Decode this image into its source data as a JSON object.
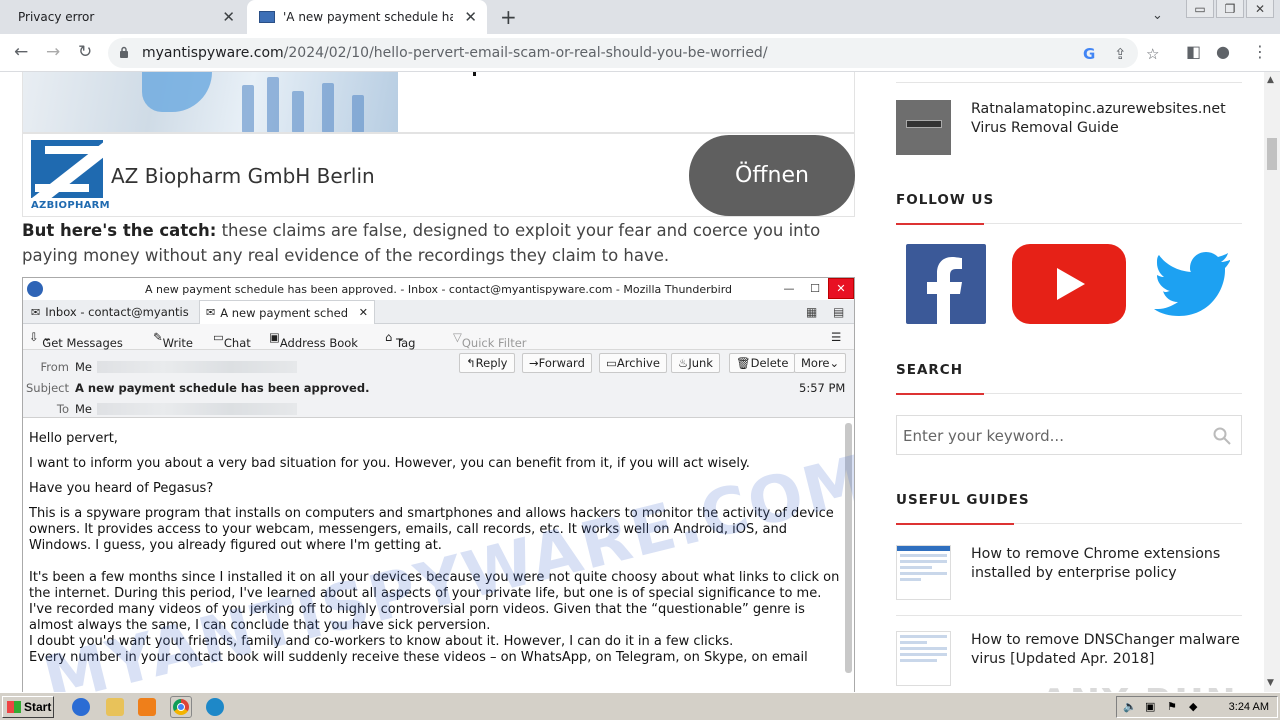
{
  "browser": {
    "tabs": [
      {
        "title": "Privacy error",
        "active": false
      },
      {
        "title": "'A new payment schedule has been a",
        "active": true
      }
    ],
    "url_host": "myantispyware.com",
    "url_path": "/2024/02/10/hello-pervert-email-scam-or-real-should-you-be-worried/"
  },
  "ad": {
    "logo_text": "AZBIOPHARM",
    "title": "AZ Biopharm GmbH Berlin",
    "button": "Öffnen"
  },
  "article": {
    "catch_bold": "But here's the catch:",
    "catch_text": " these claims are false, designed to exploit your fear and coerce you into paying money without any real evidence of the recordings they claim to have."
  },
  "thunderbird": {
    "window_title": "A new payment schedule has been approved. - Inbox - contact@myantispyware.com - Mozilla Thunderbird",
    "tab1": "Inbox - contact@myantis",
    "tab2": "A new payment sched",
    "tools": {
      "get_messages": "Get Messages",
      "write": "Write",
      "chat": "Chat",
      "address_book": "Address Book",
      "tag": "Tag",
      "quick_filter": "Quick Filter"
    },
    "header": {
      "from_label": "From",
      "from_value": "Me",
      "subject_label": "Subject",
      "subject_value": "A new payment schedule has been approved.",
      "to_label": "To",
      "to_value": "Me",
      "time": "5:57 PM",
      "buttons": {
        "reply": "Reply",
        "forward": "Forward",
        "archive": "Archive",
        "junk": "Junk",
        "delete": "Delete",
        "more": "More"
      }
    },
    "body": [
      "Hello pervert,",
      "I want to inform you about a very bad situation for you. However, you can benefit from it, if you will act wisely.",
      "Have you heard of Pegasus?",
      "This is a spyware program that installs on computers and smartphones and allows hackers to monitor the activity of device owners. It provides access to your webcam, messengers, emails, call records, etc. It works well on Android, iOS, and Windows. I guess, you already figured out where I'm getting at.",
      "It's been a few months since I installed it on all your devices because you were not quite choosy about what links to click on the internet. During this period, I've learned about all aspects of your private life, but one is of special significance to me.",
      "I've recorded many videos of you jerking off to highly controversial porn videos. Given that the “questionable” genre is almost always the same, I can conclude that you have sick perversion.",
      "I doubt you'd want your friends, family and co-workers to know about it. However, I can do it in a few clicks.",
      "Every number in your contact book will suddenly receive these videos – on WhatsApp, on Telegram, on Skype, on email"
    ],
    "watermark": "MYANTISPYWARE.COM"
  },
  "sidebar": {
    "top_item": "Ratnalamatopinc.azurewebsites.net Virus Removal Guide",
    "follow_title": "FOLLOW US",
    "search_title": "SEARCH",
    "search_placeholder": "Enter your keyword...",
    "guides_title": "USEFUL GUIDES",
    "guides": [
      "How to remove Chrome extensions installed by enterprise policy",
      "How to remove DNSChanger malware virus [Updated Apr. 2018]"
    ],
    "overlay": "ANY RUN"
  },
  "taskbar": {
    "start": "Start",
    "time": "3:24 AM"
  },
  "colors": {
    "facebook": "#3b5998",
    "youtube": "#e62117",
    "twitter": "#1da1f2",
    "accent_red": "#dd3333"
  }
}
